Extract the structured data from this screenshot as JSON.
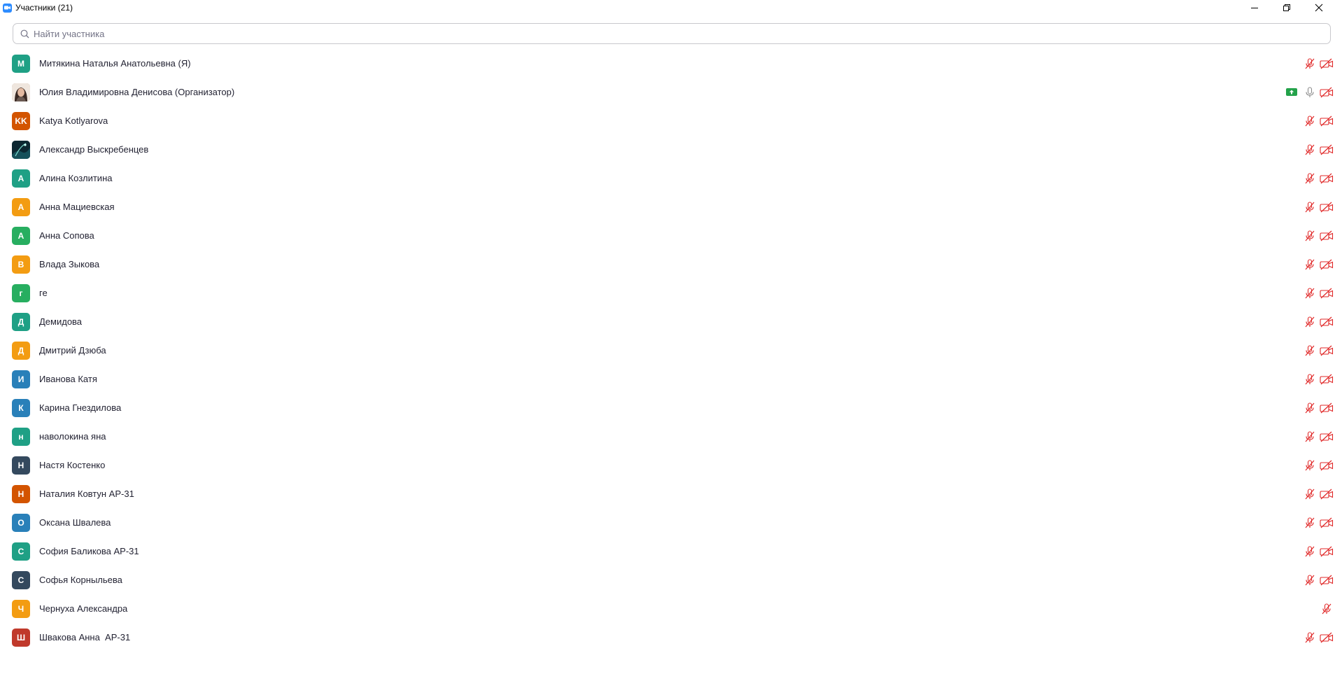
{
  "window": {
    "title": "Участники (21)",
    "icons": {
      "app": "zoom-camera-icon",
      "minimize": "minimize-icon",
      "restore": "restore-icon",
      "close": "close-icon"
    }
  },
  "search": {
    "placeholder": "Найти участника",
    "value": "",
    "icon": "search-icon"
  },
  "colors": {
    "muted_red": "#e02828",
    "mic_on_gray": "#8a8a8a",
    "share_green": "#23a24a"
  },
  "participants": [
    {
      "initials": "М",
      "name": "Митякина Наталья Анатольевна (Я)",
      "avatar_color": "#1fa085",
      "mic": "muted",
      "video": "off"
    },
    {
      "initials": "",
      "name": "Юлия Владимировна Денисова (Организатор)",
      "avatar_color": "#b98f7a",
      "avatar_type": "photo-woman",
      "mic": "on",
      "video": "off",
      "sharing": true
    },
    {
      "initials": "KK",
      "name": "Katya Kotlyarova",
      "avatar_color": "#d35400",
      "mic": "muted",
      "video": "off"
    },
    {
      "initials": "",
      "name": "Александр Выскребенцев",
      "avatar_color": "#0e2f3a",
      "avatar_type": "photo-dark",
      "mic": "muted",
      "video": "off"
    },
    {
      "initials": "А",
      "name": "Алина Козлитина",
      "avatar_color": "#1fa085",
      "mic": "muted",
      "video": "off"
    },
    {
      "initials": "А",
      "name": "Анна Мациевская",
      "avatar_color": "#f39c12",
      "mic": "muted",
      "video": "off"
    },
    {
      "initials": "А",
      "name": "Анна Сопова",
      "avatar_color": "#27ae60",
      "mic": "muted",
      "video": "off"
    },
    {
      "initials": "В",
      "name": "Влада Зыкова",
      "avatar_color": "#f39c12",
      "mic": "muted",
      "video": "off"
    },
    {
      "initials": "г",
      "name": "ге",
      "avatar_color": "#27ae60",
      "mic": "muted",
      "video": "off"
    },
    {
      "initials": "Д",
      "name": "Демидова",
      "avatar_color": "#1fa085",
      "mic": "muted",
      "video": "off"
    },
    {
      "initials": "Д",
      "name": "Дмитрий Дзюба",
      "avatar_color": "#f39c12",
      "mic": "muted",
      "video": "off"
    },
    {
      "initials": "И",
      "name": "Иванова Катя",
      "avatar_color": "#2980b9",
      "mic": "muted",
      "video": "off"
    },
    {
      "initials": "К",
      "name": "Карина Гнездилова",
      "avatar_color": "#2980b9",
      "mic": "muted",
      "video": "off"
    },
    {
      "initials": "н",
      "name": "наволокина яна",
      "avatar_color": "#1fa085",
      "mic": "muted",
      "video": "off"
    },
    {
      "initials": "Н",
      "name": "Настя Костенко",
      "avatar_color": "#34495e",
      "mic": "muted",
      "video": "off"
    },
    {
      "initials": "Н",
      "name": "Наталия Ковтун АР-31",
      "avatar_color": "#d35400",
      "mic": "muted",
      "video": "off"
    },
    {
      "initials": "О",
      "name": "Оксана Швалева",
      "avatar_color": "#2980b9",
      "mic": "muted",
      "video": "off"
    },
    {
      "initials": "С",
      "name": "София Баликова АР-31",
      "avatar_color": "#1fa085",
      "mic": "muted",
      "video": "off"
    },
    {
      "initials": "С",
      "name": "Софья Корныльева",
      "avatar_color": "#34495e",
      "mic": "muted",
      "video": "off"
    },
    {
      "initials": "Ч",
      "name": "Чернуха Александра",
      "avatar_color": "#f39c12",
      "mic": "muted",
      "video": "none"
    },
    {
      "initials": "Ш",
      "name": "Швакова Анна  АР-31",
      "avatar_color": "#c0392b",
      "mic": "muted",
      "video": "off"
    }
  ]
}
